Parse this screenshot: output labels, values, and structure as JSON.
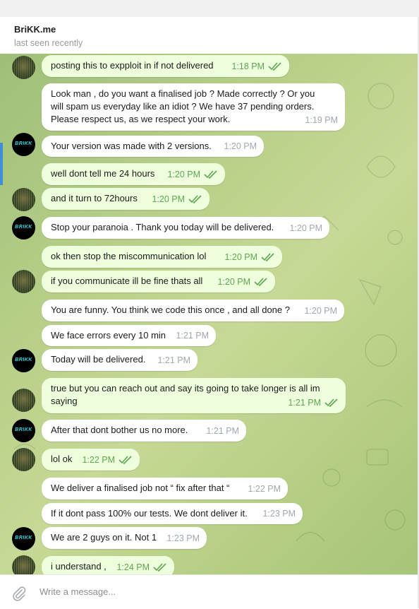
{
  "chat": {
    "name": "BriKK.me",
    "status": "last seen recently"
  },
  "messages": [
    {
      "text": "posting this to expploit in if not delivered",
      "time": "1:18 PM",
      "out": true,
      "read": true
    },
    {
      "text": "Look man , do you want a finalised job ? Made correctly ? Or you\nwill spam us everyday like an idiot ? We have 37 pending orders.\nPlease respect us, as we respect your work.",
      "time": "1:19 PM",
      "out": false,
      "read": false
    },
    {
      "text": "Your version was made with 2 versions.",
      "time": "1:20 PM",
      "out": false,
      "read": false
    },
    {
      "text": "well dont tell me 24 hours",
      "time": "1:20 PM",
      "out": true,
      "read": true
    },
    {
      "text": "and it turn to 72hours",
      "time": "1:20 PM",
      "out": true,
      "read": true
    },
    {
      "text": "Stop your paranoia . Thank you today will be delivered.",
      "time": "1:20 PM",
      "out": false,
      "read": false
    },
    {
      "text": "ok then stop the miscommunication lol",
      "time": "1:20 PM",
      "out": true,
      "read": true
    },
    {
      "text": "if you communicate ill be fine thats all",
      "time": "1:20 PM",
      "out": true,
      "read": true
    },
    {
      "text": "You are funny. You think we code this once , and all done ?",
      "time": "1:20 PM",
      "out": false,
      "read": false
    },
    {
      "text": "We face errors every 10 min",
      "time": "1:21 PM",
      "out": false,
      "read": false
    },
    {
      "text": "Today will be delivered.",
      "time": "1:21 PM",
      "out": false,
      "read": false
    },
    {
      "text": "true but you can reach out and say its going to take longer is all im\nsaying",
      "time": "1:21 PM",
      "out": true,
      "read": true
    },
    {
      "text": "After that dont bother us no more.",
      "time": "1:21 PM",
      "out": false,
      "read": false
    },
    {
      "text": "lol ok",
      "time": "1:22 PM",
      "out": true,
      "read": true
    },
    {
      "text": "We deliver a finalised job not “ fix after that “",
      "time": "1:22 PM",
      "out": false,
      "read": false
    },
    {
      "text": "If it dont pass 100% our tests. We dont deliver it.",
      "time": "1:23 PM",
      "out": false,
      "read": false
    },
    {
      "text": "We are 2 guys on it. Not 1",
      "time": "1:23 PM",
      "out": false,
      "read": false
    },
    {
      "text": "i understand ,",
      "time": "1:24 PM",
      "out": true,
      "read": true
    }
  ],
  "avatars": {
    "brikk_label": "BRIKK"
  },
  "composer": {
    "placeholder": "Write a message..."
  },
  "icons": [
    "paperclip-icon",
    "double-check-icon"
  ],
  "colors": {
    "outgoing_bubble": "#eeffde",
    "incoming_bubble": "#ffffff",
    "check_green": "#5fa552"
  }
}
